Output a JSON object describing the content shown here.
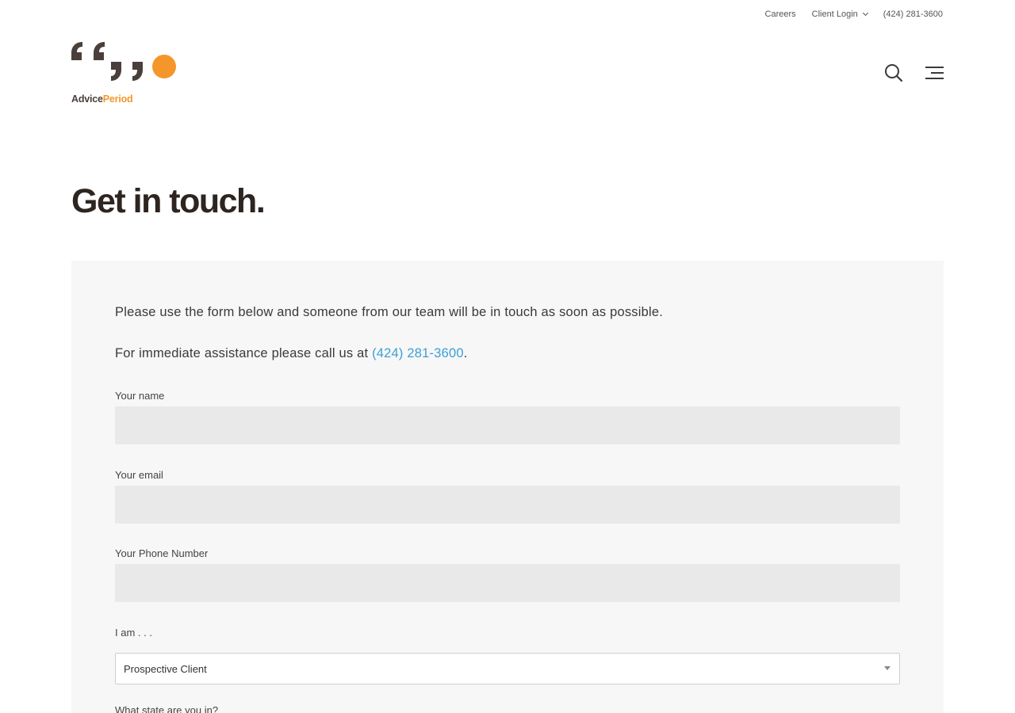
{
  "topbar": {
    "careers": "Careers",
    "client_login": "Client Login",
    "phone": "(424) 281-3600"
  },
  "logo": {
    "part1": "Advice",
    "part2": "Period",
    "colors": {
      "dark": "#4a3f3b",
      "accent": "#f5962a"
    }
  },
  "header": {
    "search_icon": "search-icon",
    "menu_icon": "hamburger-menu-icon"
  },
  "page": {
    "title": "Get in touch."
  },
  "intro": {
    "line1": "Please use the form below and someone from our team will be in touch as soon as possible.",
    "line2_prefix": "For immediate assistance please call us at ",
    "line2_link": "(424) 281-3600",
    "line2_suffix": "."
  },
  "form": {
    "name_label": "Your name",
    "name_value": "",
    "email_label": "Your email",
    "email_value": "",
    "phone_label": "Your Phone Number",
    "phone_value": "",
    "iam_label": "I am . . .",
    "iam_selected": "Prospective Client",
    "state_label": "What state are you in?"
  },
  "colors": {
    "link": "#3b9fd6",
    "title": "#2e2520",
    "panel_bg": "#f7f7f7",
    "input_bg": "#e9e9e9"
  }
}
